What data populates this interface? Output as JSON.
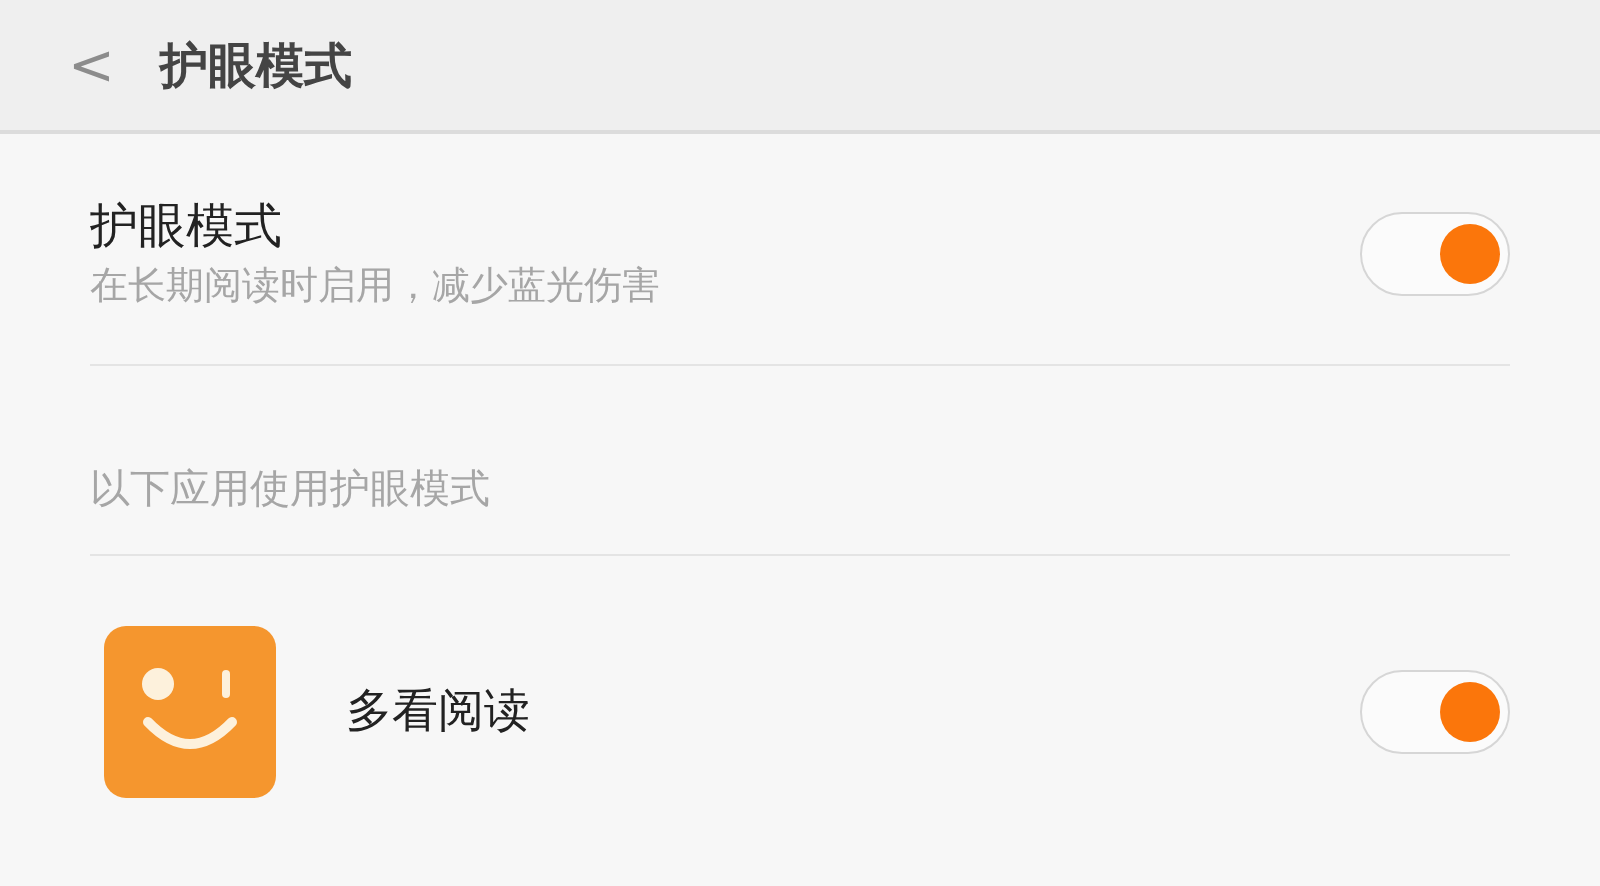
{
  "header": {
    "back": "<",
    "title": "护眼模式"
  },
  "eye_mode": {
    "title": "护眼模式",
    "subtitle": "在长期阅读时启用，减少蓝光伤害",
    "on": true
  },
  "section_label": "以下应用使用护眼模式",
  "apps": [
    {
      "name": "多看阅读",
      "on": true
    }
  ]
}
